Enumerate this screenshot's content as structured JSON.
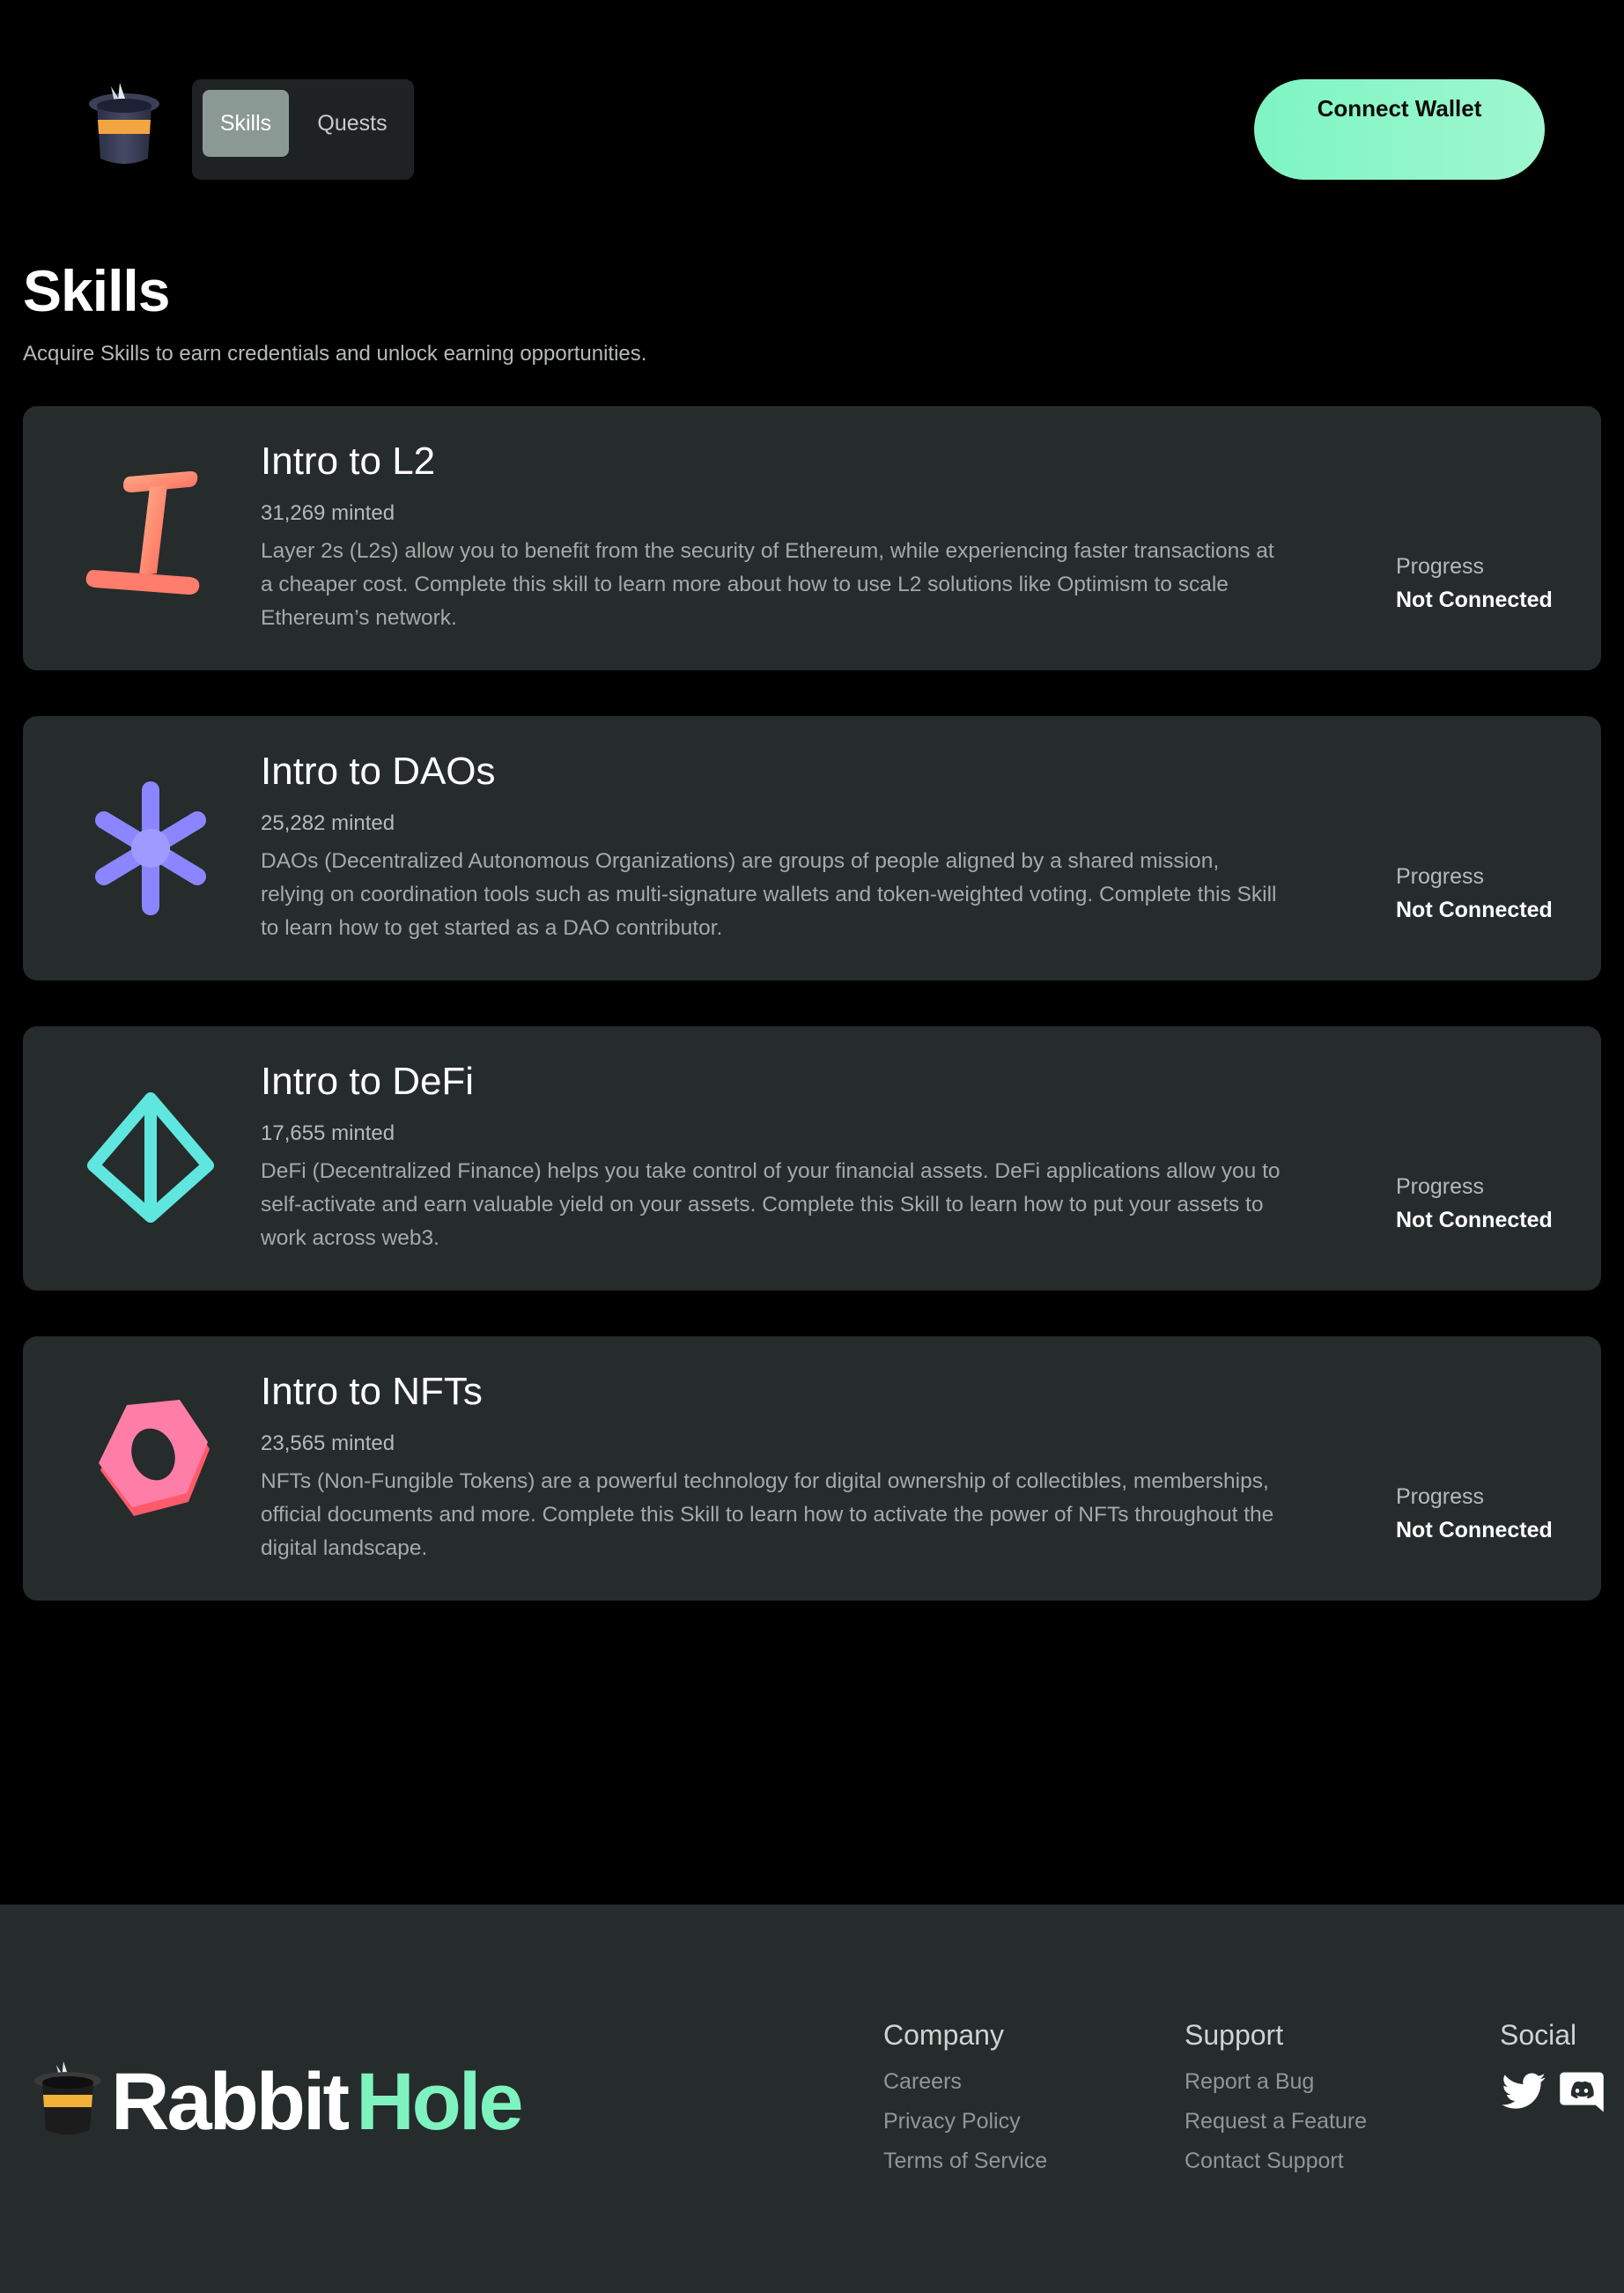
{
  "header": {
    "nav": {
      "skills_label": "Skills",
      "quests_label": "Quests",
      "active_tab": "Skills"
    },
    "connect_wallet_label": "Connect Wallet"
  },
  "page": {
    "title": "Skills",
    "subtitle": "Acquire Skills to earn credentials and unlock earning opportunities."
  },
  "skills": [
    {
      "title": "Intro to L2",
      "minted": "31,269 minted",
      "description": "Layer 2s (L2s) allow you to benefit from the security of Ethereum, while experiencing faster transactions at a cheaper cost. Complete this skill to learn more about how to use L2 solutions like Optimism to scale Ethereum’s network.",
      "progress_label": "Progress",
      "progress_value": "Not Connected",
      "icon": "l2-beam-icon",
      "color": "#ff7a6b"
    },
    {
      "title": "Intro to DAOs",
      "minted": "25,282 minted",
      "description": "DAOs (Decentralized Autonomous Organizations) are groups of people aligned by a shared mission, relying on coordination tools such as multi-signature wallets and token-weighted voting. Complete this Skill to learn how to get started as a DAO contributor.",
      "progress_label": "Progress",
      "progress_value": "Not Connected",
      "icon": "dao-jack-icon",
      "color": "#8b86ff"
    },
    {
      "title": "Intro to DeFi",
      "minted": "17,655 minted",
      "description": "DeFi (Decentralized Finance) helps you take control of your financial assets. DeFi applications allow you to self-activate and earn valuable yield on your assets. Complete this Skill to learn how to put your assets to work across web3.",
      "progress_label": "Progress",
      "progress_value": "Not Connected",
      "icon": "defi-octahedron-icon",
      "color": "#5fe6df"
    },
    {
      "title": "Intro to NFTs",
      "minted": "23,565 minted",
      "description": "NFTs (Non-Fungible Tokens) are a powerful technology for digital ownership of collectibles, memberships, official documents and more. Complete this Skill to learn how to activate the power of NFTs throughout the digital landscape.",
      "progress_label": "Progress",
      "progress_value": "Not Connected",
      "icon": "nft-hex-nut-icon",
      "color": "#ff6f95"
    }
  ],
  "footer": {
    "brand": {
      "part1": "Rabbit",
      "part2": "Hole"
    },
    "company": {
      "heading": "Company",
      "links": [
        "Careers",
        "Privacy Policy",
        "Terms of Service"
      ]
    },
    "support": {
      "heading": "Support",
      "links": [
        "Report a Bug",
        "Request a Feature",
        "Contact Support"
      ]
    },
    "social": {
      "heading": "Social",
      "icons": [
        "twitter-icon",
        "discord-icon"
      ]
    }
  },
  "colors": {
    "background": "#000000",
    "card": "#262b2b",
    "accent": "#7ef5c2",
    "nav_active": "#8a9994"
  }
}
